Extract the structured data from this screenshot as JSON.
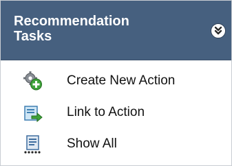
{
  "panel": {
    "title_line1": "Recommendation",
    "title_line2": "Tasks",
    "collapse_icon": "double-chevron-down-icon"
  },
  "tasks": [
    {
      "label": "Create New Action",
      "icon": "gear-plus-icon"
    },
    {
      "label": "Link to Action",
      "icon": "link-document-icon"
    },
    {
      "label": "Show All",
      "icon": "document-list-icon"
    }
  ],
  "colors": {
    "header_bg": "#46607f",
    "header_text": "#ffffff",
    "item_text": "#111111"
  }
}
